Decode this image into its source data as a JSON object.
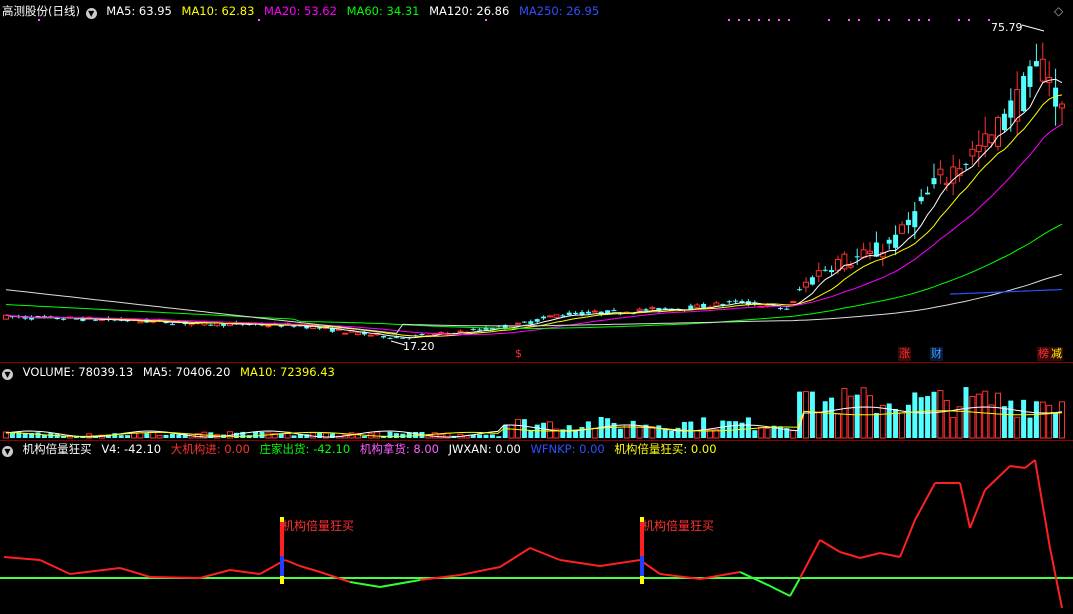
{
  "price_pane": {
    "title": "高测股份(日线)",
    "indicators": [
      {
        "label": "MA5: 63.95",
        "color": "#ffffff"
      },
      {
        "label": "MA10: 62.83",
        "color": "#ffff00"
      },
      {
        "label": "MA20: 53.62",
        "color": "#ff00ff"
      },
      {
        "label": "MA60: 34.31",
        "color": "#00ff00"
      },
      {
        "label": "MA120: 26.86",
        "color": "#ffffff"
      },
      {
        "label": "MA250: 26.95",
        "color": "#3050ff"
      }
    ],
    "high_label": "75.79",
    "low_label": "17.20",
    "tags": [
      {
        "text": "$",
        "color": "#ff3030"
      },
      {
        "text": "涨",
        "color": "#ff3030"
      },
      {
        "text": "财",
        "color": "#3fa0ff"
      },
      {
        "text": "榜",
        "color": "#ff3030"
      },
      {
        "text": "减",
        "color": "#ffff00"
      }
    ]
  },
  "volume_pane": {
    "indicators": [
      {
        "label": "VOLUME: 78039.13",
        "color": "#ffffff"
      },
      {
        "label": "MA5: 70406.20",
        "color": "#ffffff"
      },
      {
        "label": "MA10: 72396.43",
        "color": "#ffff00"
      }
    ]
  },
  "indicator_pane": {
    "name": "机构倍量狂买",
    "indicators": [
      {
        "label": "V4: -42.10",
        "color": "#ffffff"
      },
      {
        "label": "大机构进: 0.00",
        "color": "#ff3030"
      },
      {
        "label": "庄家出货: -42.10",
        "color": "#00ff00"
      },
      {
        "label": "机构拿货: 8.00",
        "color": "#ff60ff"
      },
      {
        "label": "JWXAN: 0.00",
        "color": "#ffffff"
      },
      {
        "label": "WFNKP: 0.00",
        "color": "#3050ff"
      },
      {
        "label": "机构倍量狂买: 0.00",
        "color": "#ffff00"
      }
    ],
    "signal_label": "机构倍量狂买"
  },
  "colors": {
    "up": "#ff3030",
    "down": "#54ffff",
    "frame": "#8b0000",
    "signal_text": "#ff3030"
  },
  "chart_data": [
    {
      "type": "candlestick",
      "ylim": [
        14,
        80
      ],
      "markers": {
        "high": 75.79,
        "low": 17.2
      },
      "ma_lines": [
        "MA5",
        "MA10",
        "MA20",
        "MA60",
        "MA120",
        "MA250"
      ]
    },
    {
      "type": "bar",
      "series": [
        {
          "name": "VOLUME"
        },
        {
          "name": "MA5"
        },
        {
          "name": "MA10"
        }
      ]
    },
    {
      "type": "line",
      "series": [
        {
          "name": "V4"
        }
      ],
      "signals": [
        "机构倍量狂买",
        "机构倍量狂买"
      ]
    }
  ]
}
